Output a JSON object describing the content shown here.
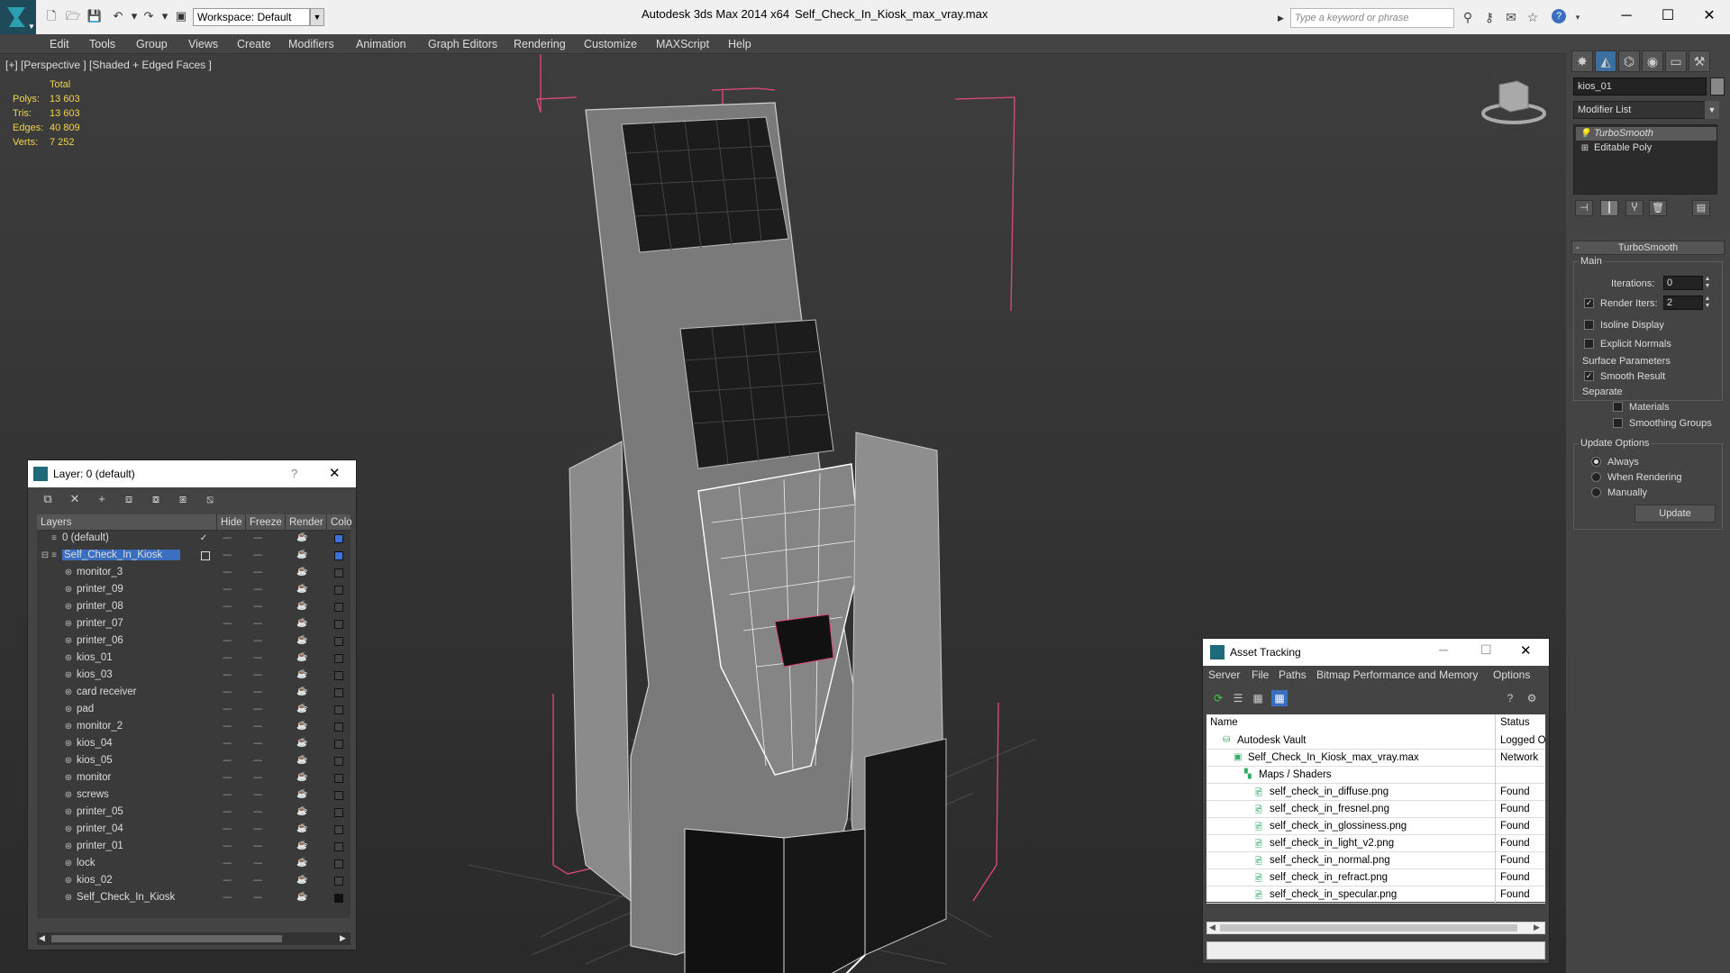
{
  "window": {
    "app_title": "Autodesk 3ds Max  2014 x64",
    "file_title": "Self_Check_In_Kiosk_max_vray.max",
    "workspace": "Workspace: Default",
    "search_placeholder": "Type a keyword or phrase"
  },
  "menu": [
    "Edit",
    "Tools",
    "Group",
    "Views",
    "Create",
    "Modifiers",
    "Animation",
    "Graph Editors",
    "Rendering",
    "Customize",
    "MAXScript",
    "Help"
  ],
  "viewport": {
    "label": "[+] [Perspective ] [Shaded + Edged Faces ]",
    "stats": {
      "header": "Total",
      "rows": [
        {
          "label": "Polys:",
          "value": "13 603"
        },
        {
          "label": "Tris:",
          "value": "13 603"
        },
        {
          "label": "Edges:",
          "value": "40 809"
        },
        {
          "label": "Verts:",
          "value": "7 252"
        }
      ]
    }
  },
  "command_panel": {
    "object_name": "kios_01",
    "modifier_list": "Modifier List",
    "stack": [
      "TurboSmooth",
      "Editable Poly"
    ],
    "rollout_title": "TurboSmooth",
    "main_label": "Main",
    "iterations_label": "Iterations:",
    "iterations_value": "0",
    "render_iters_label": "Render Iters:",
    "render_iters_value": "2",
    "isoline": "Isoline Display",
    "explicit_normals": "Explicit Normals",
    "surface_params": "Surface Parameters",
    "smooth_result": "Smooth Result",
    "separate": "Separate",
    "materials": "Materials",
    "smoothing_groups": "Smoothing Groups",
    "update_options": "Update Options",
    "always": "Always",
    "when_rendering": "When Rendering",
    "manually": "Manually",
    "update_button": "Update"
  },
  "layer_dialog": {
    "title": "Layer: 0 (default)",
    "help": "?",
    "columns": [
      "Layers",
      "Hide",
      "Freeze",
      "Render",
      "Colo"
    ],
    "rows": [
      {
        "name": "0 (default)",
        "level": 0,
        "color": "#3f6fd8"
      },
      {
        "name": "Self_Check_In_Kiosk",
        "level": 0,
        "color": "#3f6fd8",
        "selected": true
      },
      {
        "name": "monitor_3",
        "level": 1,
        "color": "#444444"
      },
      {
        "name": "printer_09",
        "level": 1,
        "color": "#444444"
      },
      {
        "name": "printer_08",
        "level": 1,
        "color": "#444444"
      },
      {
        "name": "printer_07",
        "level": 1,
        "color": "#444444"
      },
      {
        "name": "printer_06",
        "level": 1,
        "color": "#444444"
      },
      {
        "name": "kios_01",
        "level": 1,
        "color": "#444444"
      },
      {
        "name": "kios_03",
        "level": 1,
        "color": "#444444"
      },
      {
        "name": "card receiver",
        "level": 1,
        "color": "#444444"
      },
      {
        "name": "pad",
        "level": 1,
        "color": "#444444"
      },
      {
        "name": "monitor_2",
        "level": 1,
        "color": "#444444"
      },
      {
        "name": "kios_04",
        "level": 1,
        "color": "#444444"
      },
      {
        "name": "kios_05",
        "level": 1,
        "color": "#444444"
      },
      {
        "name": "monitor",
        "level": 1,
        "color": "#444444"
      },
      {
        "name": "screws",
        "level": 1,
        "color": "#444444"
      },
      {
        "name": "printer_05",
        "level": 1,
        "color": "#444444"
      },
      {
        "name": "printer_04",
        "level": 1,
        "color": "#444444"
      },
      {
        "name": "printer_01",
        "level": 1,
        "color": "#444444"
      },
      {
        "name": "lock",
        "level": 1,
        "color": "#444444"
      },
      {
        "name": "kios_02",
        "level": 1,
        "color": "#444444"
      },
      {
        "name": "Self_Check_In_Kiosk",
        "level": 1,
        "color": "#111111"
      }
    ]
  },
  "asset_dialog": {
    "title": "Asset Tracking",
    "menu": [
      "Server",
      "File",
      "Paths",
      "Bitmap Performance and Memory",
      "Options"
    ],
    "columns": [
      "Name",
      "Status"
    ],
    "rows": [
      {
        "name": "Autodesk Vault",
        "status": "Logged O",
        "level": 1,
        "icon": "vault-icon"
      },
      {
        "name": "Self_Check_In_Kiosk_max_vray.max",
        "status": "Network",
        "level": 2,
        "icon": "max-file-icon"
      },
      {
        "name": "Maps / Shaders",
        "status": "",
        "level": 3,
        "icon": "maps-icon"
      },
      {
        "name": "self_check_in_diffuse.png",
        "status": "Found",
        "level": 4,
        "icon": "image-file-icon"
      },
      {
        "name": "self_check_in_fresnel.png",
        "status": "Found",
        "level": 4,
        "icon": "image-file-icon"
      },
      {
        "name": "self_check_in_glossiness.png",
        "status": "Found",
        "level": 4,
        "icon": "image-file-icon"
      },
      {
        "name": "self_check_in_light_v2.png",
        "status": "Found",
        "level": 4,
        "icon": "image-file-icon"
      },
      {
        "name": "self_check_in_normal.png",
        "status": "Found",
        "level": 4,
        "icon": "image-file-icon"
      },
      {
        "name": "self_check_in_refract.png",
        "status": "Found",
        "level": 4,
        "icon": "image-file-icon"
      },
      {
        "name": "self_check_in_specular.png",
        "status": "Found",
        "level": 4,
        "icon": "image-file-icon"
      }
    ]
  }
}
